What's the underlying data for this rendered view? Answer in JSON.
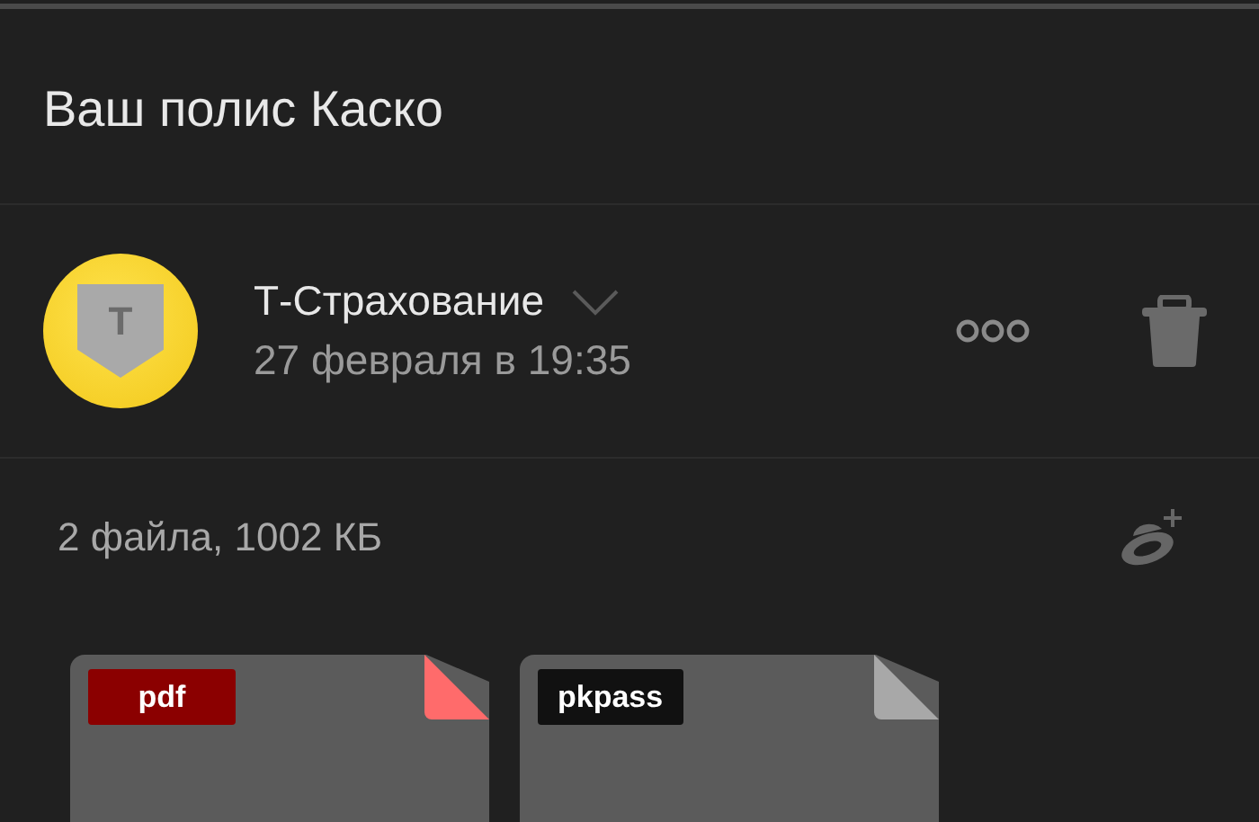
{
  "header": {
    "title": "Ваш полис Каско"
  },
  "message": {
    "avatar_letter": "Т",
    "sender": "Т-Страхование",
    "date": "27 февраля в 19:35",
    "expanded": false
  },
  "attachments": {
    "summary": "2 файла, 1002 КБ",
    "files": [
      {
        "type": "pdf",
        "kind": "pdf",
        "color": "#8b0000"
      },
      {
        "type": "pkpass",
        "kind": "generic",
        "color": "#111111"
      }
    ]
  }
}
